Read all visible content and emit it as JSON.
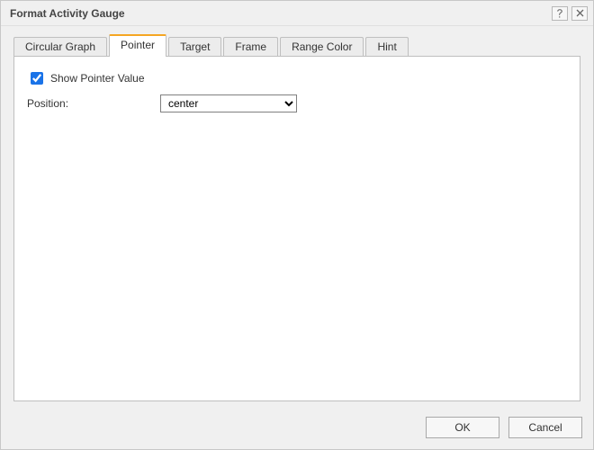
{
  "dialog": {
    "title": "Format Activity Gauge"
  },
  "tabs": {
    "t0": "Circular Graph",
    "t1": "Pointer",
    "t2": "Target",
    "t3": "Frame",
    "t4": "Range Color",
    "t5": "Hint"
  },
  "pointer": {
    "show_label": "Show Pointer Value",
    "position_label": "Position:",
    "position_value": "center"
  },
  "footer": {
    "ok": "OK",
    "cancel": "Cancel"
  }
}
